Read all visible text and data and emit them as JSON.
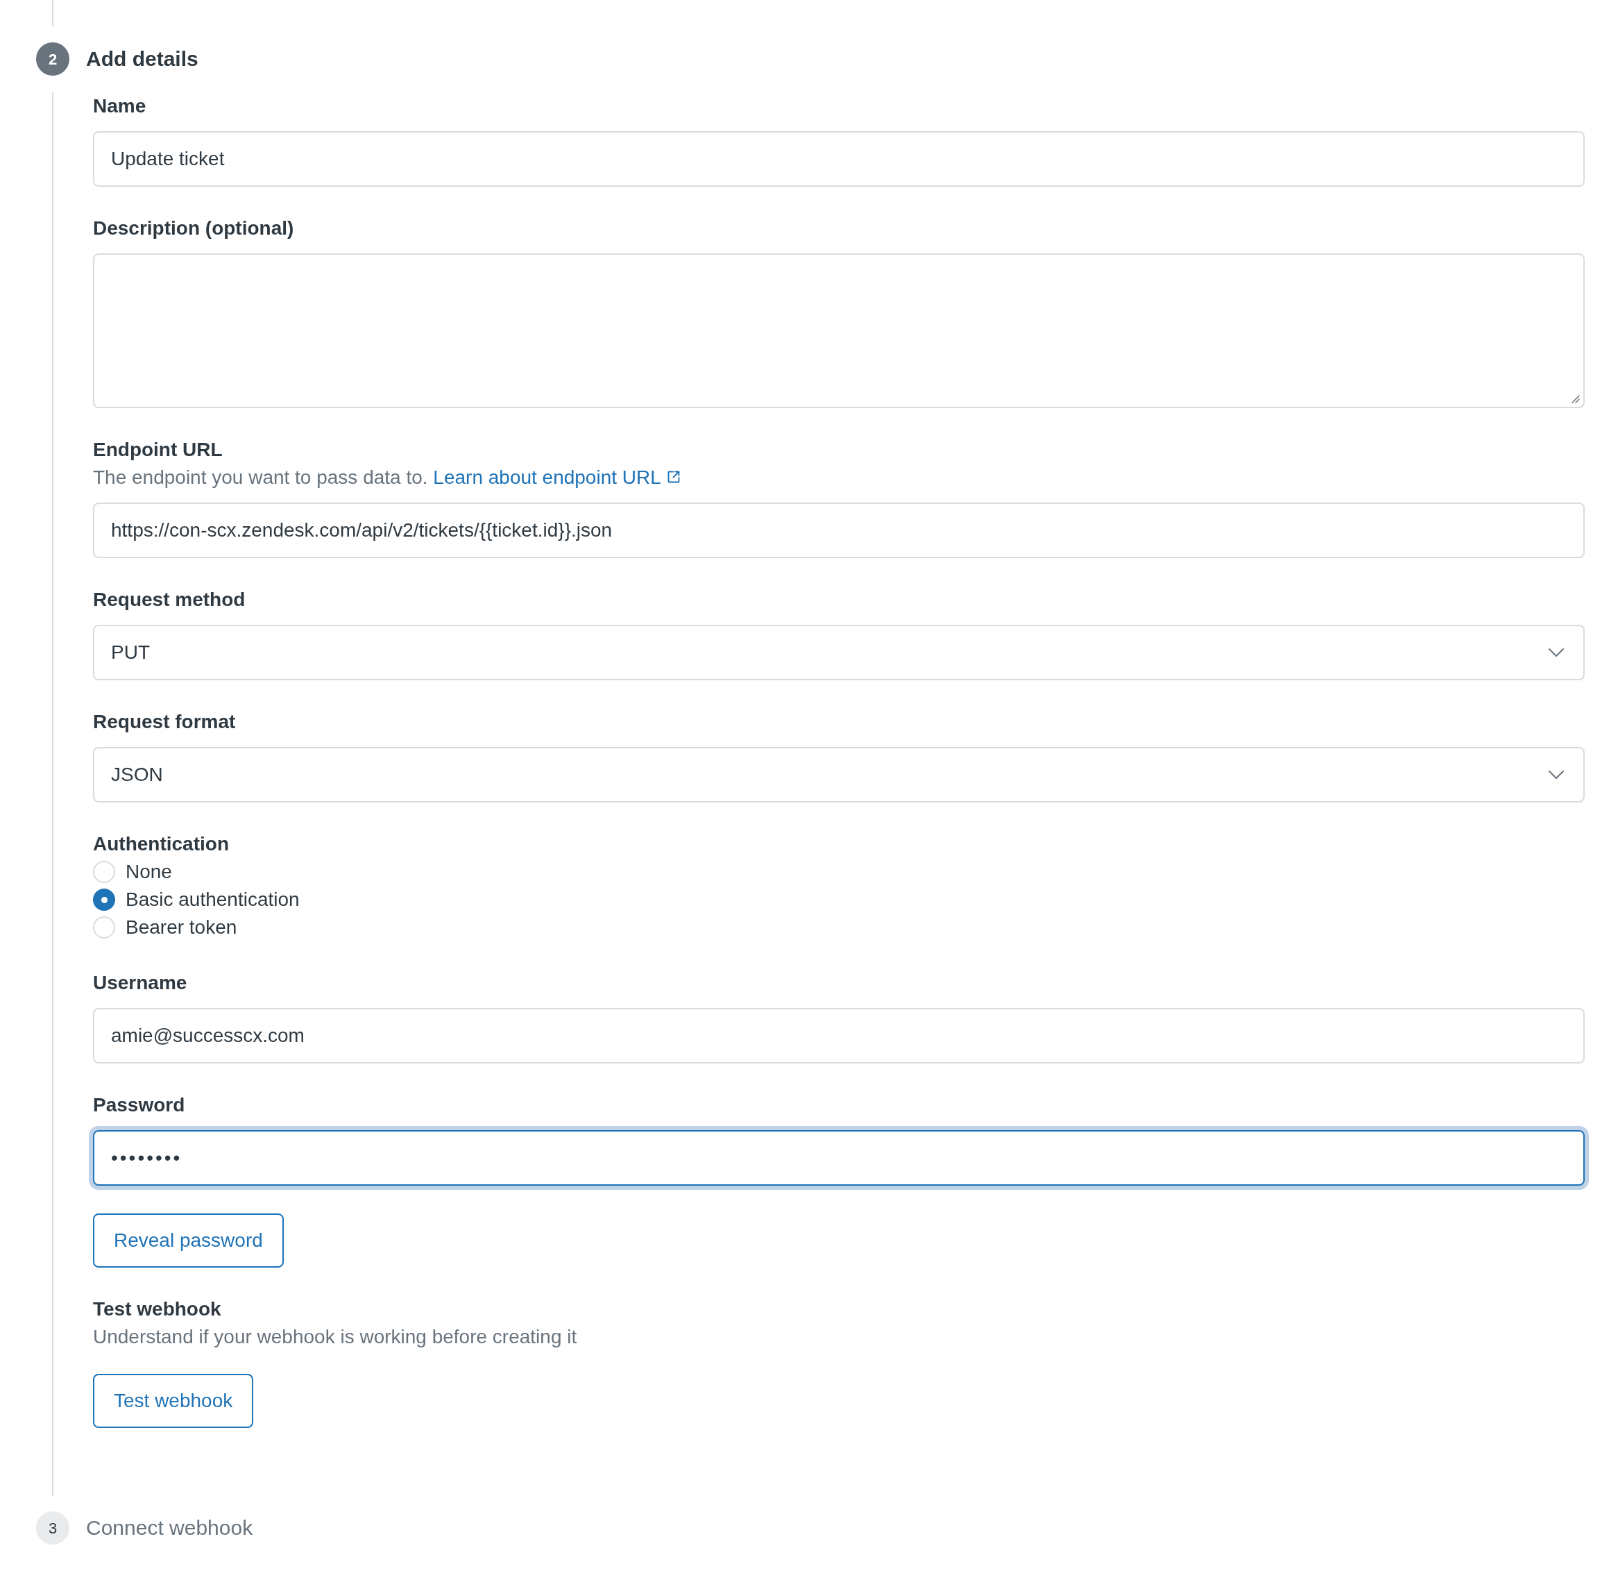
{
  "steps": [
    {
      "number": "2",
      "title": "Add details",
      "current": true,
      "fields": [
        {
          "kind": "text",
          "label": "Name",
          "value": "Update ticket",
          "focused": false
        },
        {
          "kind": "textarea",
          "label": "Description (optional)",
          "focused": false
        },
        {
          "kind": "text",
          "label": "Endpoint URL",
          "hint": "The endpoint you want to pass data to.",
          "hint_link": "Learn about endpoint URL",
          "value": "https://con-scx.zendesk.com/api/v2/tickets/{{ticket.id}}.json",
          "focused": false
        },
        {
          "kind": "select",
          "label": "Request method",
          "value": "PUT",
          "focused": false
        },
        {
          "kind": "select",
          "label": "Request format",
          "value": "JSON",
          "focused": false
        },
        {
          "kind": "radio",
          "label": "Authentication",
          "options": [
            {
              "label": "None",
              "selected": false
            },
            {
              "label": "Basic authentication",
              "selected": true
            },
            {
              "label": "Bearer token",
              "selected": false
            }
          ]
        },
        {
          "kind": "text",
          "label": "Username",
          "value": "amie@successcx.com",
          "focused": false
        },
        {
          "kind": "password",
          "label": "Password",
          "value": "••••••••",
          "focused": true
        },
        {
          "kind": "button",
          "label": "Reveal password"
        },
        {
          "kind": "section",
          "title": "Test webhook",
          "hint": "Understand if your webhook is working before creating it",
          "button": "Test webhook"
        }
      ]
    },
    {
      "number": "3",
      "title": "Connect webhook",
      "current": false
    }
  ]
}
